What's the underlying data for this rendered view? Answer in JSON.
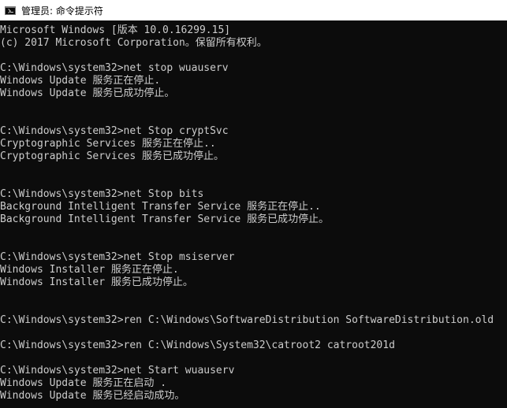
{
  "window": {
    "title": "管理员: 命令提示符",
    "icon": "cmd-icon"
  },
  "colors": {
    "background": "#0c0c0c",
    "foreground": "#cccccc",
    "titlebar": "#ffffff"
  },
  "console": {
    "lines": [
      "Microsoft Windows [版本 10.0.16299.15]",
      "(c) 2017 Microsoft Corporation。保留所有权利。",
      "",
      "C:\\Windows\\system32>net stop wuauserv",
      "Windows Update 服务正在停止.",
      "Windows Update 服务已成功停止。",
      "",
      "",
      "C:\\Windows\\system32>net Stop cryptSvc",
      "Cryptographic Services 服务正在停止..",
      "Cryptographic Services 服务已成功停止。",
      "",
      "",
      "C:\\Windows\\system32>net Stop bits",
      "Background Intelligent Transfer Service 服务正在停止..",
      "Background Intelligent Transfer Service 服务已成功停止。",
      "",
      "",
      "C:\\Windows\\system32>net Stop msiserver",
      "Windows Installer 服务正在停止.",
      "Windows Installer 服务已成功停止。",
      "",
      "",
      "C:\\Windows\\system32>ren C:\\Windows\\SoftwareDistribution SoftwareDistribution.old",
      "",
      "C:\\Windows\\system32>ren C:\\Windows\\System32\\catroot2 catroot201d",
      "",
      "C:\\Windows\\system32>net Start wuauserv",
      "Windows Update 服务正在启动 .",
      "Windows Update 服务已经启动成功。"
    ]
  }
}
